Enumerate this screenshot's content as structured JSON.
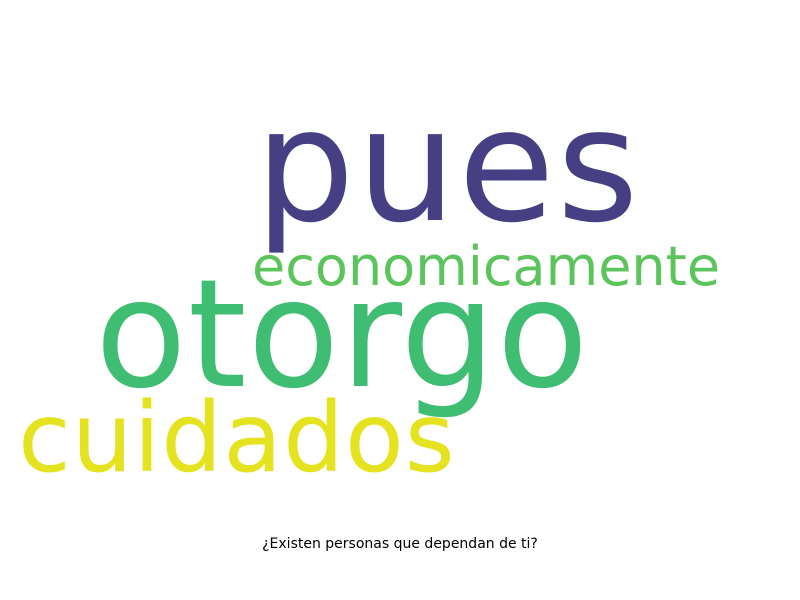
{
  "wordcloud": {
    "words": [
      {
        "text": "pues",
        "color": "#463f84"
      },
      {
        "text": "economicamente",
        "color": "#5cc45c"
      },
      {
        "text": "otorgo",
        "color": "#3fbd72"
      },
      {
        "text": "cuidados",
        "color": "#e5e21f"
      }
    ]
  },
  "caption": {
    "text": "¿Existen personas que dependan de ti?"
  }
}
